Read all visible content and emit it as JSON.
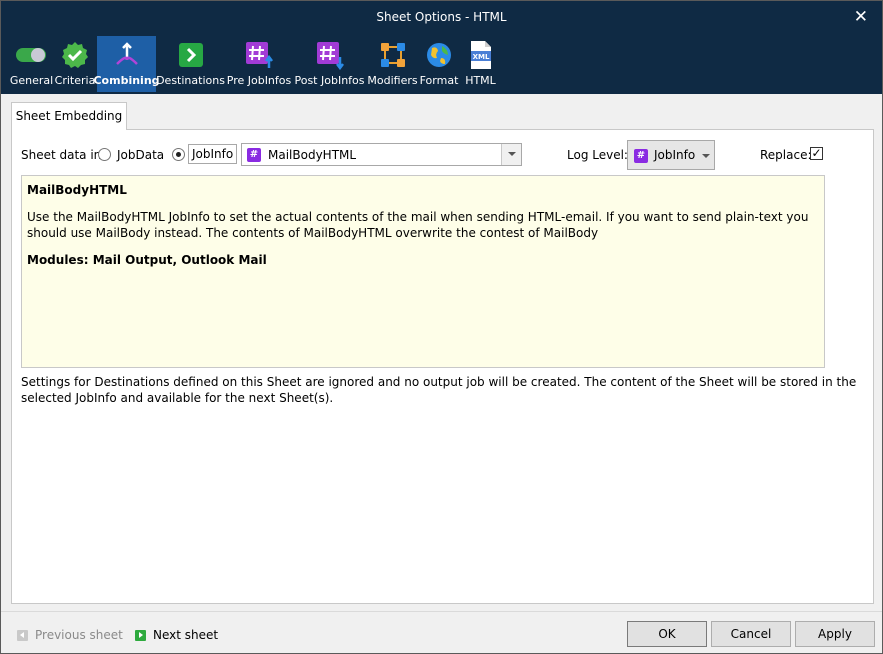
{
  "window": {
    "title": "Sheet Options - HTML"
  },
  "toolbar": {
    "items": [
      {
        "label": "General"
      },
      {
        "label": "Criteria"
      },
      {
        "label": "Combining"
      },
      {
        "label": "Destinations"
      },
      {
        "label": "Pre JobInfos"
      },
      {
        "label": "Post JobInfos"
      },
      {
        "label": "Modifiers"
      },
      {
        "label": "Format"
      },
      {
        "label": "HTML"
      }
    ],
    "active": "Combining",
    "xml_icon_text": "XML"
  },
  "tab": {
    "label": "Sheet Embedding"
  },
  "sheet_data": {
    "label": "Sheet data in:",
    "option_jobdata": "JobData",
    "option_jobinfo": "JobInfo",
    "selected": "JobInfo",
    "combo_value": "MailBodyHTML",
    "hash_icon": "#"
  },
  "log_level": {
    "label": "Log Level:",
    "value": "JobInfo"
  },
  "replace": {
    "label": "Replace:",
    "checked": true,
    "mark": "✓"
  },
  "help": {
    "heading": "MailBodyHTML",
    "body": "Use the MailBodyHTML JobInfo to set the actual contents of the mail when sending HTML-email. If you want to send plain-text you should use MailBody instead. The contents of MailBodyHTML overwrite the contest of MailBody",
    "modules": "Modules: Mail Output, Outlook Mail"
  },
  "note": "Settings for Destinations defined on this Sheet are ignored and no output job will be created. The content of the Sheet will be stored in the selected JobInfo and available for the next Sheet(s).",
  "footer": {
    "previous": "Previous sheet",
    "next": "Next sheet",
    "ok": "OK",
    "cancel": "Cancel",
    "apply": "Apply"
  },
  "colors": {
    "titlebar": "#0f2a44",
    "active_tab": "#1e5fa6",
    "help_bg": "#fefee8",
    "jobinfo_purple": "#8a2be2"
  }
}
